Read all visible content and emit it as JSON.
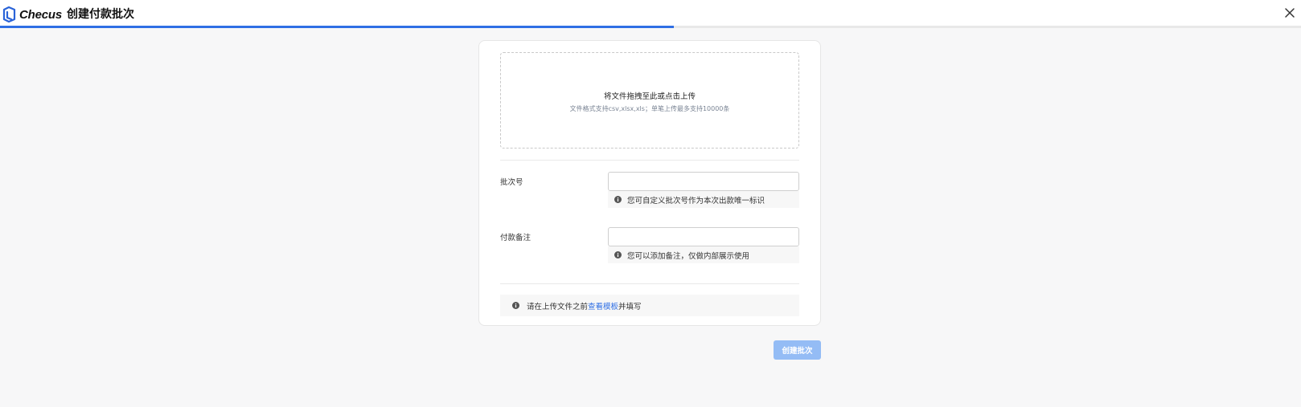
{
  "header": {
    "logo_text": "Checus",
    "title": "创建付款批次",
    "progress": 0.518
  },
  "upload": {
    "title": "将文件拖拽至此或点击上传",
    "hint": "文件格式支持csv,xlsx,xls；单笔上传最多支持10000条"
  },
  "form": {
    "batch_number": {
      "label": "批次号",
      "value": "",
      "hint": "您可自定义批次号作为本次出款唯一标识"
    },
    "payment_remark": {
      "label": "付款备注",
      "value": "",
      "hint": "您可以添加备注，仅做内部展示使用"
    }
  },
  "notice": {
    "prefix": "请在上传文件之前",
    "link": "查看模板",
    "suffix": "并填写"
  },
  "actions": {
    "create_label": "创建批次"
  },
  "colors": {
    "accent": "#2f6fe4",
    "button_disabled": "#94bcf5",
    "logo_blue": "#2a63d8"
  },
  "icons": {
    "logo": "checus-logo-icon",
    "close": "close-icon",
    "info": "info-icon"
  }
}
